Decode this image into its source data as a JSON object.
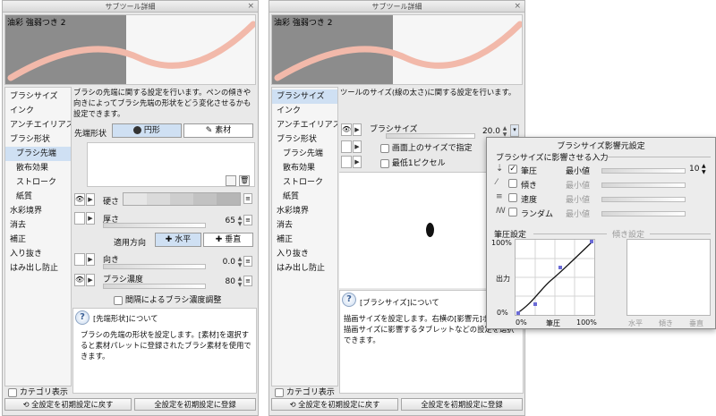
{
  "window_title": "サブツール詳細",
  "preview_title": "油彩 強弱つき 2",
  "left": {
    "categories": [
      "ブラシサイズ",
      "インク",
      "アンチエイリアス",
      "ブラシ形状",
      "ブラシ先端",
      "散布効果",
      "ストローク",
      "紙質",
      "水彩境界",
      "消去",
      "補正",
      "入り抜き",
      "はみ出し防止"
    ],
    "selected": 4,
    "description": "ブラシの先端に関する設定を行います。ペンの傾きや向きによってブラシ先端の形状をどう変化させるかも設定できます。",
    "tip_shape_label": "先端形状",
    "tip_round": "円形",
    "tip_material": "素材",
    "hardness_label": "硬さ",
    "thickness_label": "厚さ",
    "thickness_value": "65",
    "apply_dir_label": "適用方向",
    "horizontal": "水平",
    "vertical": "垂直",
    "direction_label": "向き",
    "direction_value": "0.0",
    "brush_density_label": "ブラシ濃度",
    "brush_density_value": "80",
    "interval_density_label": "間隔によるブラシ濃度調整",
    "info_title": "[先端形状]について",
    "info_body": "ブラシの先端の形状を設定します。[素材]を選択すると素材パレットに登録されたブラシ素材を使用できます。",
    "show_category": "カテゴリ表示",
    "reset_button": "全設定を初期設定に戻す",
    "register_button": "全設定を初期設定に登録"
  },
  "right": {
    "categories": [
      "ブラシサイズ",
      "インク",
      "アンチエイリアス",
      "ブラシ形状",
      "ブラシ先端",
      "散布効果",
      "ストローク",
      "紙質",
      "水彩境界",
      "消去",
      "補正",
      "入り抜き",
      "はみ出し防止"
    ],
    "selected": 0,
    "description": "ツールのサイズ(線の太さ)に関する設定を行います。",
    "brush_size_label": "ブラシサイズ",
    "brush_size_value": "20.0",
    "screen_size_label": "画面上のサイズで指定",
    "min_pixel_label": "最低1ピクセル",
    "info_title": "[ブラシサイズ]について",
    "info_body": "描画サイズを設定します。右横の[影響元]ボタンで、描画サイズに影響するタブレットなどの設定を選択できます。",
    "show_category": "カテゴリ表示",
    "reset_button": "全設定を初期設定に戻す",
    "register_button": "全設定を初期設定に登録"
  },
  "popup": {
    "title": "ブラシサイズ影響元設定",
    "section": "ブラシサイズに影響させる入力",
    "inputs": [
      {
        "label": "筆圧",
        "checked": true,
        "min_label": "最小値",
        "value": "10"
      },
      {
        "label": "傾き",
        "checked": false,
        "min_label": "最小値",
        "value": ""
      },
      {
        "label": "速度",
        "checked": false,
        "min_label": "最小値",
        "value": ""
      },
      {
        "label": "ランダム",
        "checked": false,
        "min_label": "最小値",
        "value": ""
      }
    ],
    "pressure_setting": "筆圧設定",
    "tilt_setting": "傾き設定",
    "y_100": "100%",
    "y_output": "出力",
    "y_0": "0%",
    "x_0": "0%",
    "x_pressure": "筆圧",
    "x_100": "100%",
    "tilt_x_horizontal": "水平",
    "tilt_x_tilt": "傾き",
    "tilt_x_vertical": "垂直"
  },
  "colors": {
    "selection": "#cfe0f3",
    "accent": "#3a5f95",
    "gray_preview": "#8c8c8c",
    "stroke": "#f2b9aa"
  }
}
